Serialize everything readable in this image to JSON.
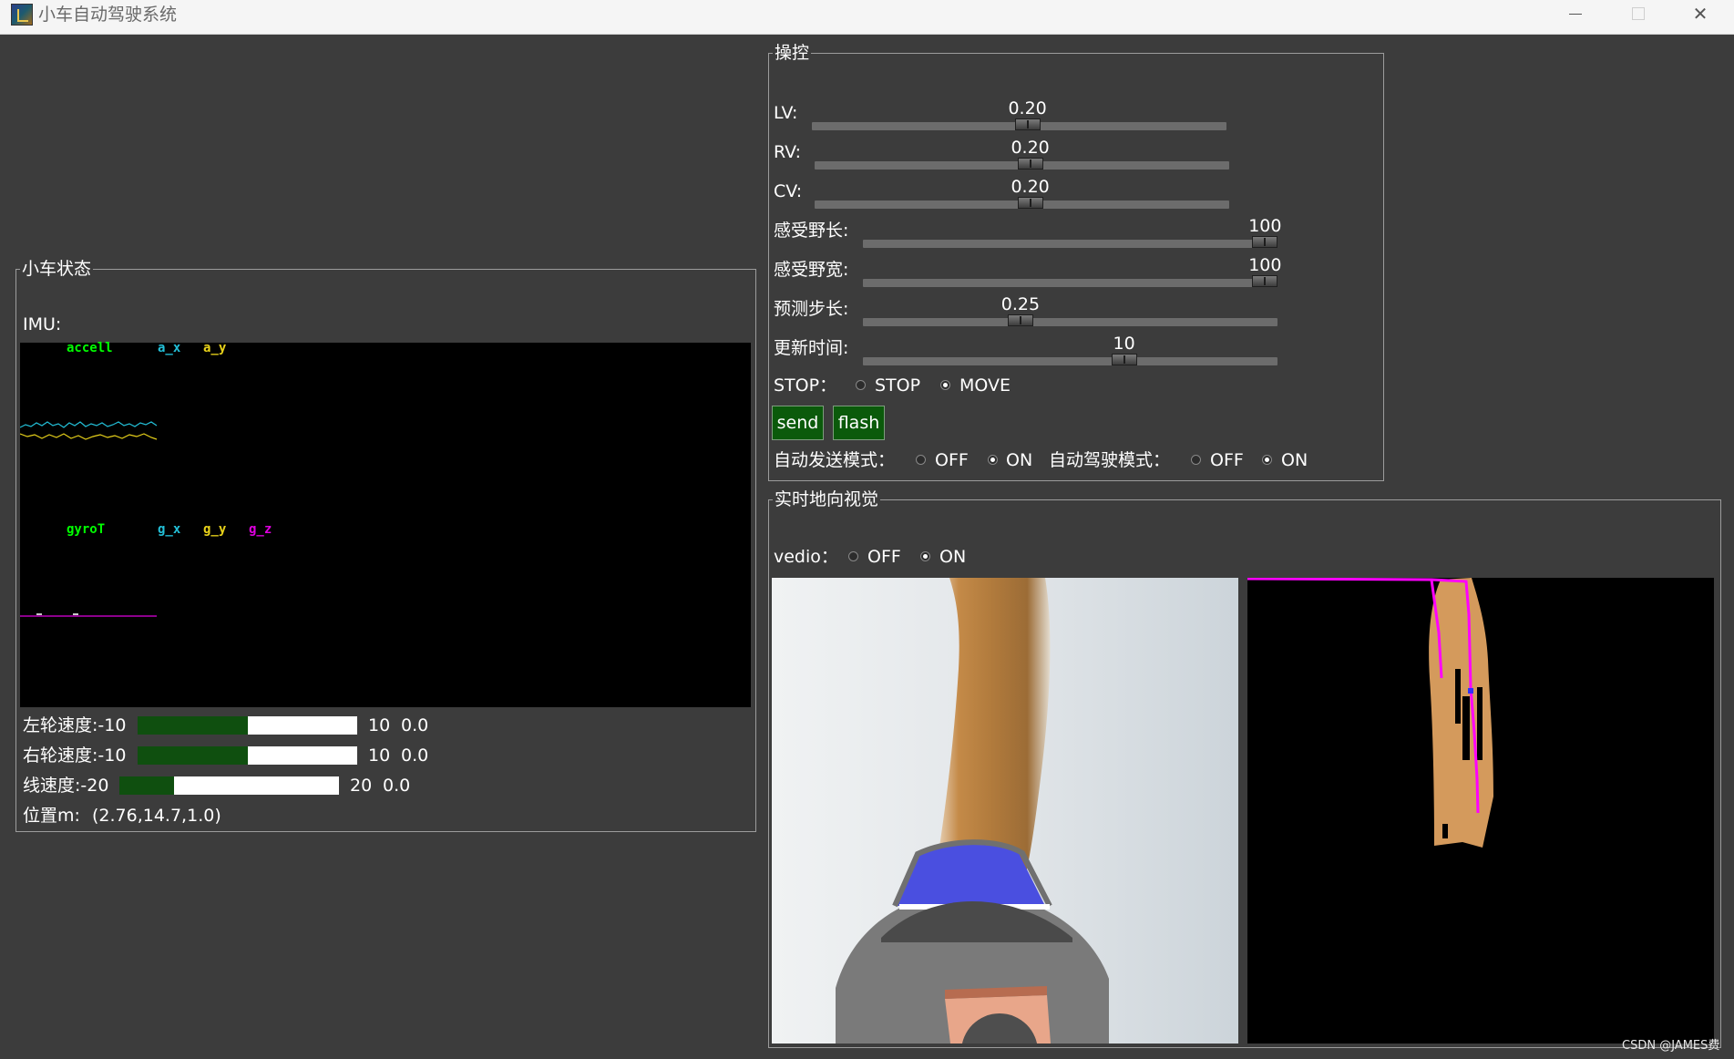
{
  "window": {
    "title": "小车自动驾驶系统",
    "app_icon": "app-icon",
    "controls": [
      "minimize-icon",
      "maximize-icon",
      "close-icon"
    ],
    "close_glyph": "✕"
  },
  "status_panel": {
    "title": "小车状态",
    "imu_label": "IMU:",
    "accel_legend": {
      "title": "accell",
      "x": "a_x",
      "y": "a_y"
    },
    "gyro_legend": {
      "title": "gyroT",
      "x": "g_x",
      "y": "g_y",
      "z": "g_z"
    },
    "left_wheel": {
      "label": "左轮速度:-10",
      "max": "10",
      "value": "0.0",
      "fraction": 0.5
    },
    "right_wheel": {
      "label": "右轮速度:-10",
      "max": "10",
      "value": "0.0",
      "fraction": 0.5
    },
    "line_speed": {
      "label": "线速度:-20",
      "max": "20",
      "value": "0.0",
      "fraction": 0.25
    },
    "position": {
      "label": "位置m:",
      "value": "(2.76,14.7,1.0)"
    }
  },
  "control_panel": {
    "title": "操控",
    "sliders": [
      {
        "label": "LV:",
        "value": "0.20",
        "fraction": 0.52
      },
      {
        "label": "RV:",
        "value": "0.20",
        "fraction": 0.52
      },
      {
        "label": "CV:",
        "value": "0.20",
        "fraction": 0.52
      },
      {
        "label": "感受野长:",
        "value": "100",
        "fraction": 0.97
      },
      {
        "label": "感受野宽:",
        "value": "100",
        "fraction": 0.97
      },
      {
        "label": "预测步长:",
        "value": "0.25",
        "fraction": 0.38
      },
      {
        "label": "更新时间:",
        "value": "10",
        "fraction": 0.63
      }
    ],
    "stop_label": "STOP：",
    "stop_options": [
      {
        "label": "STOP",
        "selected": false
      },
      {
        "label": "MOVE",
        "selected": true
      }
    ],
    "send_label": "send",
    "flash_label": "flash",
    "auto_send_label": "自动发送模式：",
    "auto_send_options": [
      {
        "label": "OFF",
        "selected": false
      },
      {
        "label": "ON",
        "selected": true
      }
    ],
    "auto_drive_label": "自动驾驶模式：",
    "auto_drive_options": [
      {
        "label": "OFF",
        "selected": false
      },
      {
        "label": "ON",
        "selected": true
      }
    ]
  },
  "vision_panel": {
    "title": "实时地向视觉",
    "video_label": "vedio：",
    "video_options": [
      {
        "label": "OFF",
        "selected": false
      },
      {
        "label": "ON",
        "selected": true
      }
    ]
  },
  "watermark": "CSDN @JAMES费",
  "colors": {
    "background": "#3c3c3c",
    "progress_fill": "#0f4f0f",
    "button_green": "#0b5a0b",
    "accel_x": "#23c0d8",
    "accel_y": "#e8d21a",
    "gyro_z": "#e000e0",
    "legend_green": "#00ff00"
  }
}
